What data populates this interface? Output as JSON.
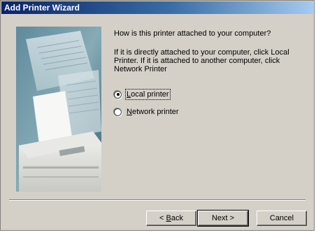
{
  "window": {
    "title": "Add Printer Wizard"
  },
  "side_image": {
    "name": "printer-illustration"
  },
  "content": {
    "question": "How is this printer attached to your computer?",
    "info": "If it is directly attached to your computer, click Local Printer. If it is attached to another computer, click Network Printer"
  },
  "options": {
    "local": {
      "label_prefix": "",
      "label_mnemonic": "L",
      "label_rest": "ocal printer",
      "selected": true
    },
    "network": {
      "label_prefix": "",
      "label_mnemonic": "N",
      "label_rest": "etwork printer",
      "selected": false
    }
  },
  "buttons": {
    "back": {
      "prefix": "< ",
      "mnemonic": "B",
      "rest": "ack"
    },
    "next": {
      "label": "Next >"
    },
    "cancel": {
      "label": "Cancel"
    }
  },
  "colors": {
    "titlebar_start": "#0a246a",
    "titlebar_end": "#a6caf0",
    "dialog_bg": "#d4d0c8"
  }
}
